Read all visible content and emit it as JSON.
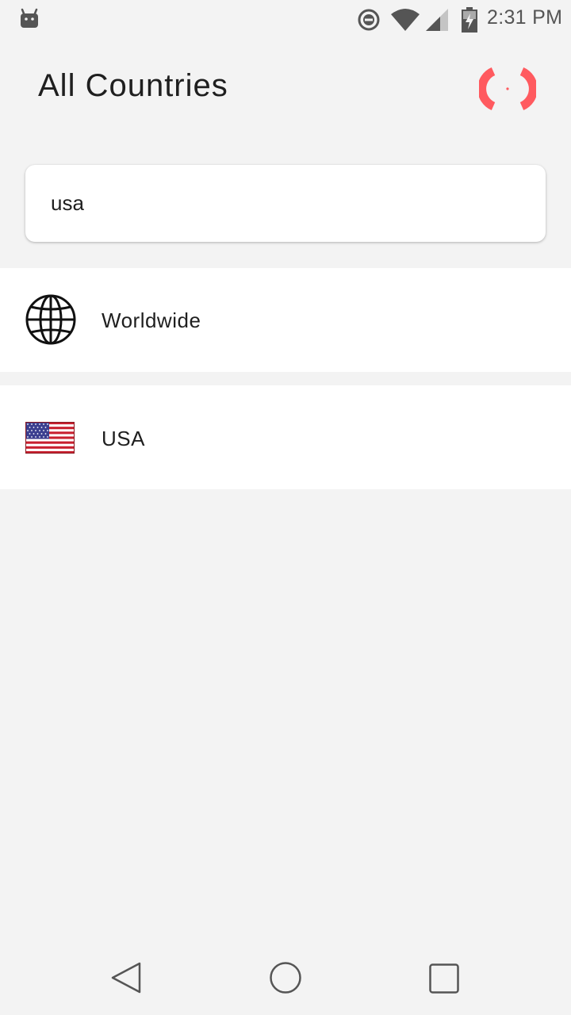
{
  "status_bar": {
    "time": "2:31 PM",
    "icons": [
      "android-icon",
      "do-not-disturb-icon",
      "wifi-icon",
      "signal-icon",
      "battery-charging-icon"
    ]
  },
  "header": {
    "title": "All Countries",
    "connection_icon": "connection-status-icon",
    "accent_color": "#ff5a5f"
  },
  "search": {
    "value": "usa",
    "placeholder": ""
  },
  "countries": [
    {
      "label": "Worldwide",
      "icon": "globe-icon"
    },
    {
      "label": "USA",
      "icon": "usa-flag-icon"
    }
  ],
  "nav_bar": {
    "icons": [
      "back-icon",
      "home-icon",
      "recents-icon"
    ]
  }
}
